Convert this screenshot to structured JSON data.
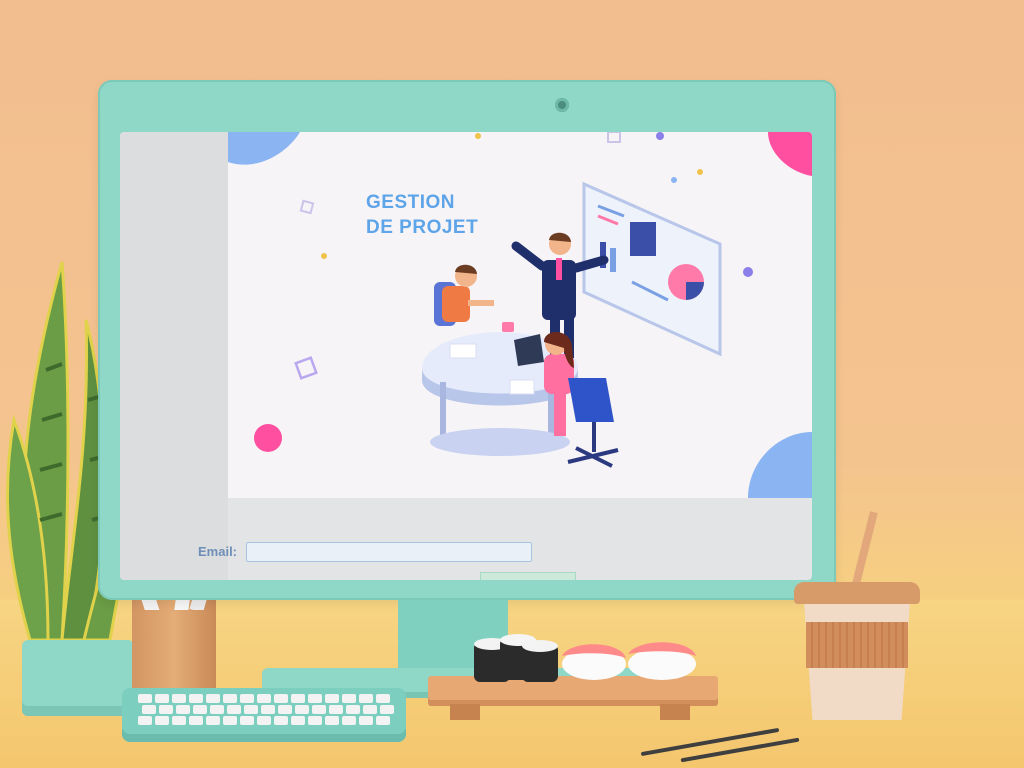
{
  "banner": {
    "title_line1": "GESTION",
    "title_line2": "DE PROJET"
  },
  "form": {
    "email_label": "Email:",
    "email_value": "",
    "email_placeholder": ""
  },
  "colors": {
    "background": "#f2bd8f",
    "monitor": "#8fd8c8",
    "title": "#5ea4e8",
    "accent_pink": "#ff4fa0"
  },
  "icons": [
    "webcam-icon",
    "plant-icon",
    "coffee-cup-icon",
    "keyboard-icon",
    "sushi-icon"
  ]
}
